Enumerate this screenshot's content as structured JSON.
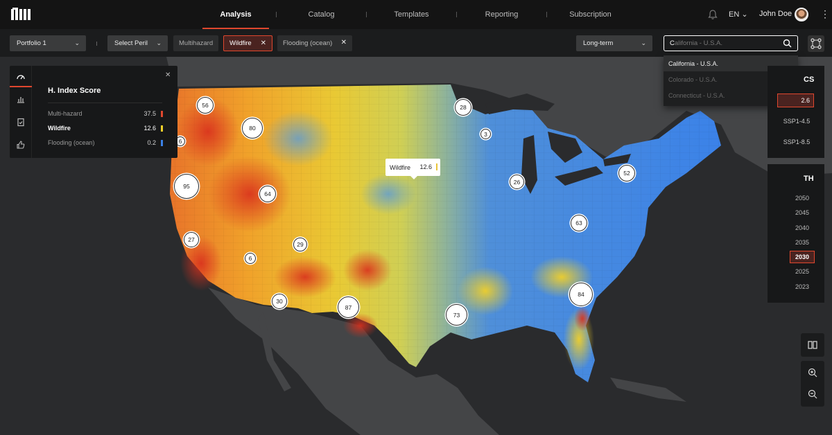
{
  "nav": {
    "tabs": [
      {
        "label": "Analysis"
      },
      {
        "label": "Catalog"
      },
      {
        "label": "Templates"
      },
      {
        "label": "Reporting"
      },
      {
        "label": "Subscription"
      }
    ],
    "language": "EN",
    "user_name": "John Doe"
  },
  "filters": {
    "portfolio": "Portfolio 1",
    "peril_select": "Select Peril",
    "chips": {
      "multihazard": "Multihazard",
      "wildfire": "Wildfire",
      "flooding": "Flooding (ocean)"
    },
    "horizon": "Long-term",
    "search_typed": "C",
    "search_ghost": "alifornia - U.S.A."
  },
  "suggestions": [
    "California - U.S.A.",
    "Colorado - U.S.A.",
    "Connecticut - U.S.A."
  ],
  "score_panel": {
    "title": "H. Index Score",
    "rows": [
      {
        "label": "Multi-hazard",
        "value": "37.5",
        "color": "#e0472e"
      },
      {
        "label": "Wildfire",
        "value": "12.6",
        "color": "#f0cf2a"
      },
      {
        "label": "Flooding (ocean)",
        "value": "0.2",
        "color": "#3b82e8"
      }
    ]
  },
  "scenario_panel": {
    "title": "CS",
    "selected": "2.6",
    "options": [
      "SSP1-4.5",
      "SSP1-8.5"
    ]
  },
  "horizon_panel": {
    "title": "TH",
    "years": [
      "2050",
      "2045",
      "2040",
      "2035",
      "2030",
      "2025",
      "2023"
    ],
    "selected": "2030"
  },
  "tooltip": {
    "label": "Wildfire",
    "value": "12.6"
  },
  "clusters": [
    "56",
    "80",
    "6",
    "95",
    "64",
    "27",
    "6",
    "29",
    "30",
    "87",
    "73",
    "28",
    "3",
    "26",
    "52",
    "63",
    "84"
  ],
  "colors": {
    "accent": "#e0472e",
    "ocean": "#2a2b2d",
    "land": "#444547",
    "high": "#e0472e",
    "mid": "#f0cf2a",
    "low": "#3b82e8"
  }
}
